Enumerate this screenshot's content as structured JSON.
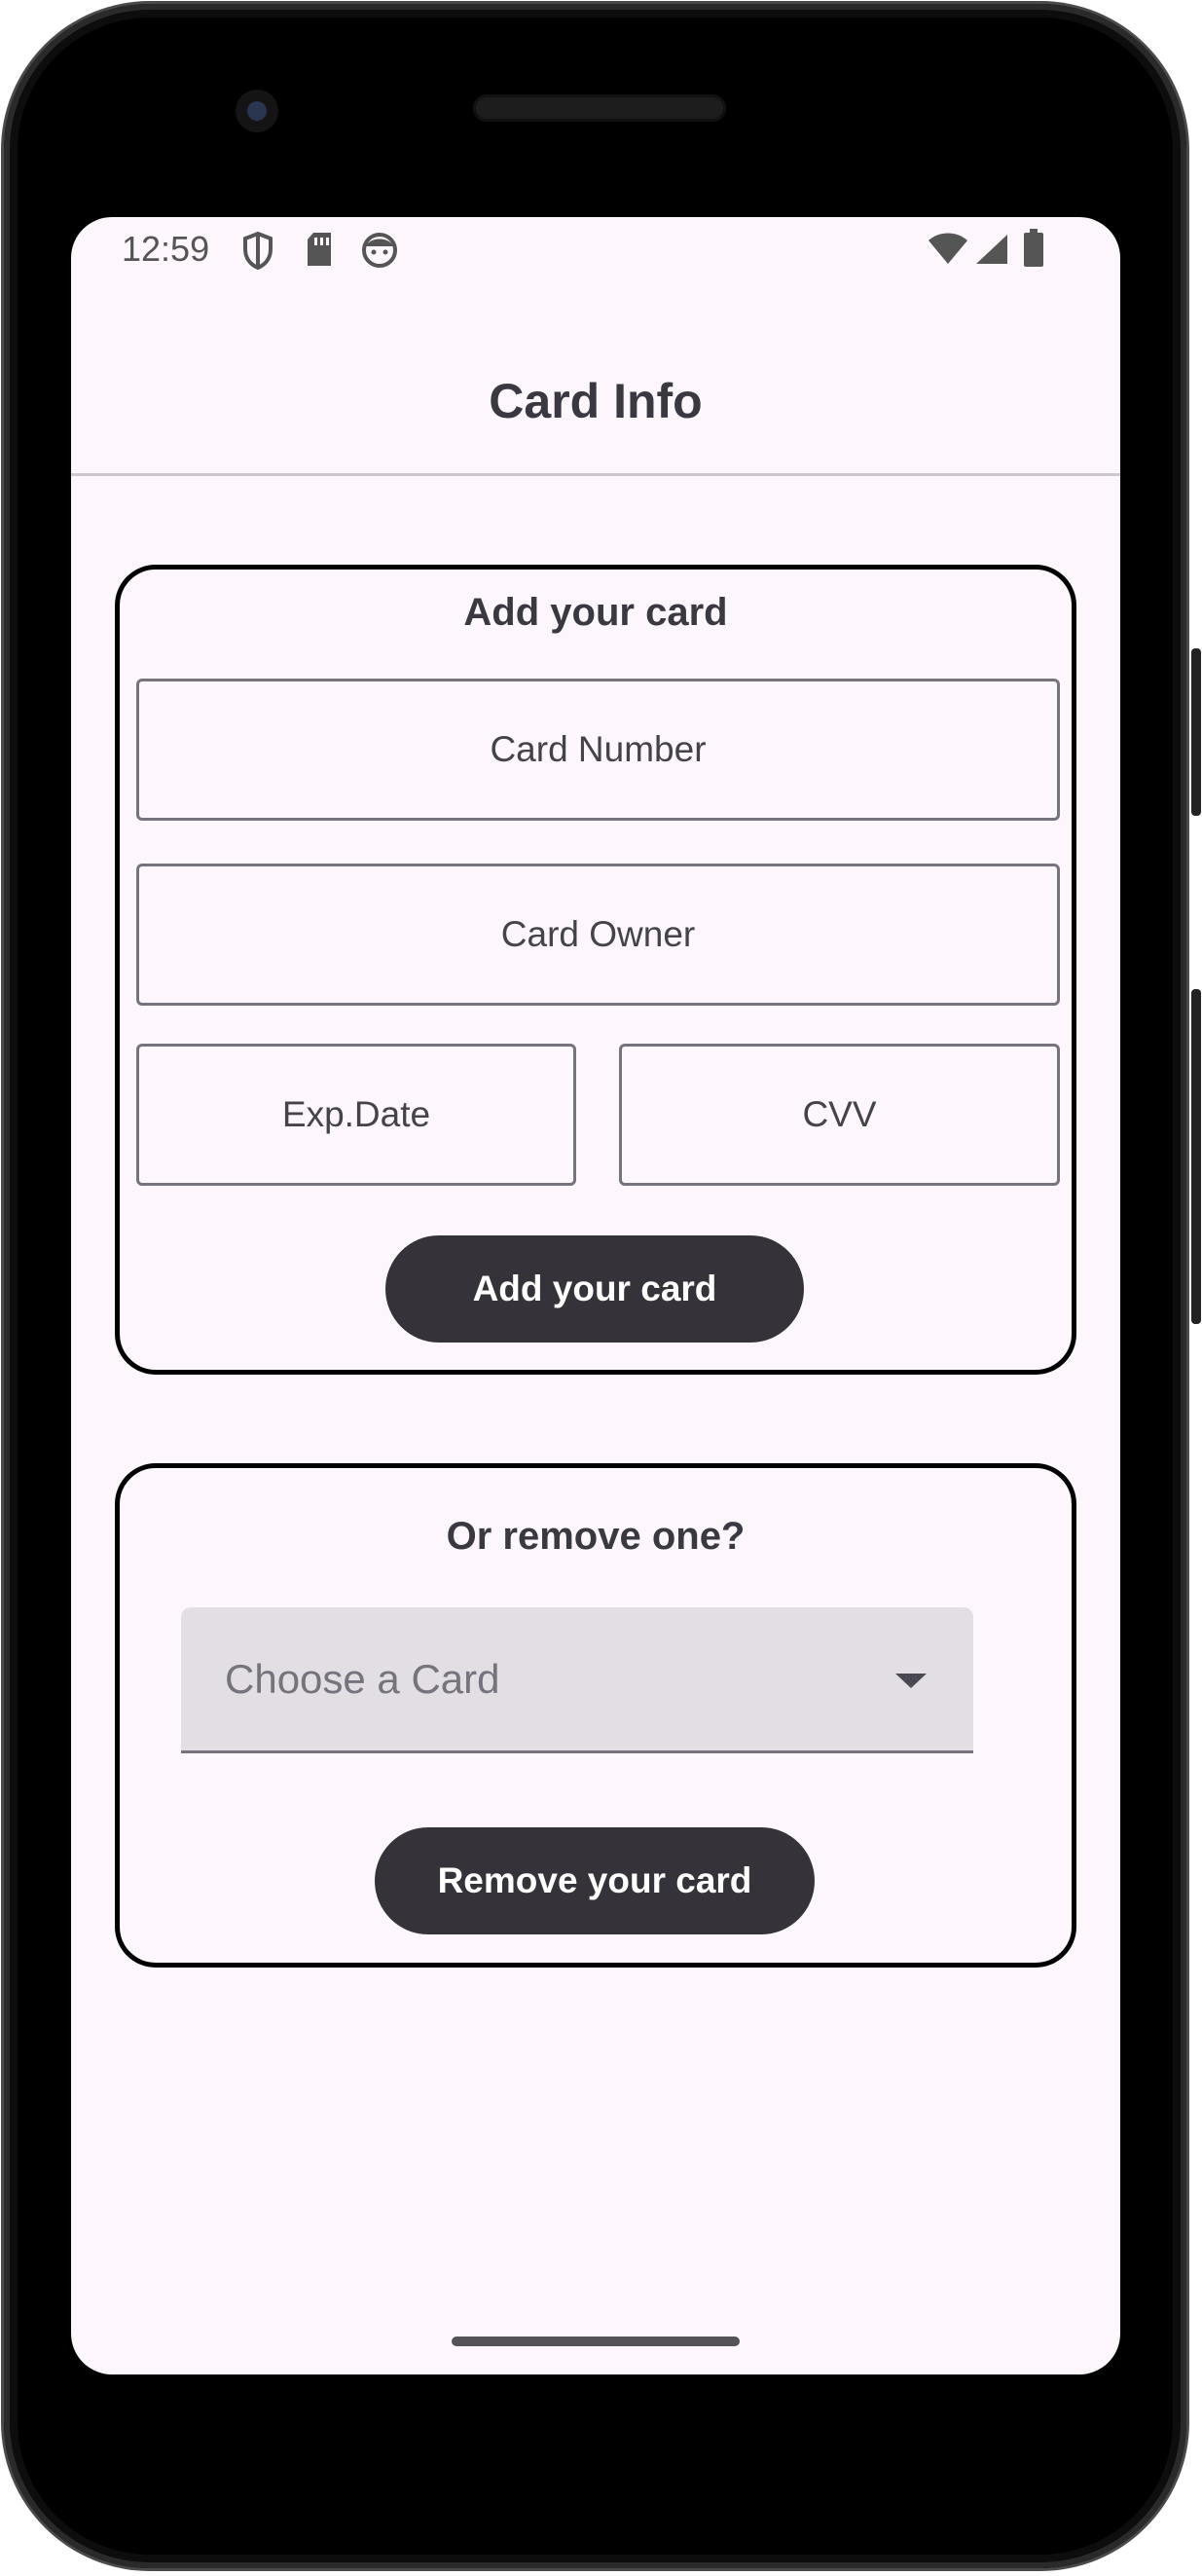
{
  "status_bar": {
    "time": "12:59",
    "left_icons": [
      "shield-icon",
      "sd-card-icon",
      "face-icon"
    ],
    "right_icons": [
      "wifi-icon",
      "signal-icon",
      "battery-icon"
    ]
  },
  "header": {
    "title": "Card Info"
  },
  "add_card": {
    "title": "Add your card",
    "card_number_placeholder": "Card Number",
    "card_owner_placeholder": "Card Owner",
    "exp_date_placeholder": "Exp.Date",
    "cvv_placeholder": "CVV",
    "button_label": "Add your card"
  },
  "remove_card": {
    "title": "Or remove one?",
    "dropdown_placeholder": "Choose a Card",
    "button_label": "Remove your card"
  },
  "colors": {
    "background": "#fdf6fc",
    "button": "#35323a",
    "dropdown_fill": "#e2dee3"
  }
}
